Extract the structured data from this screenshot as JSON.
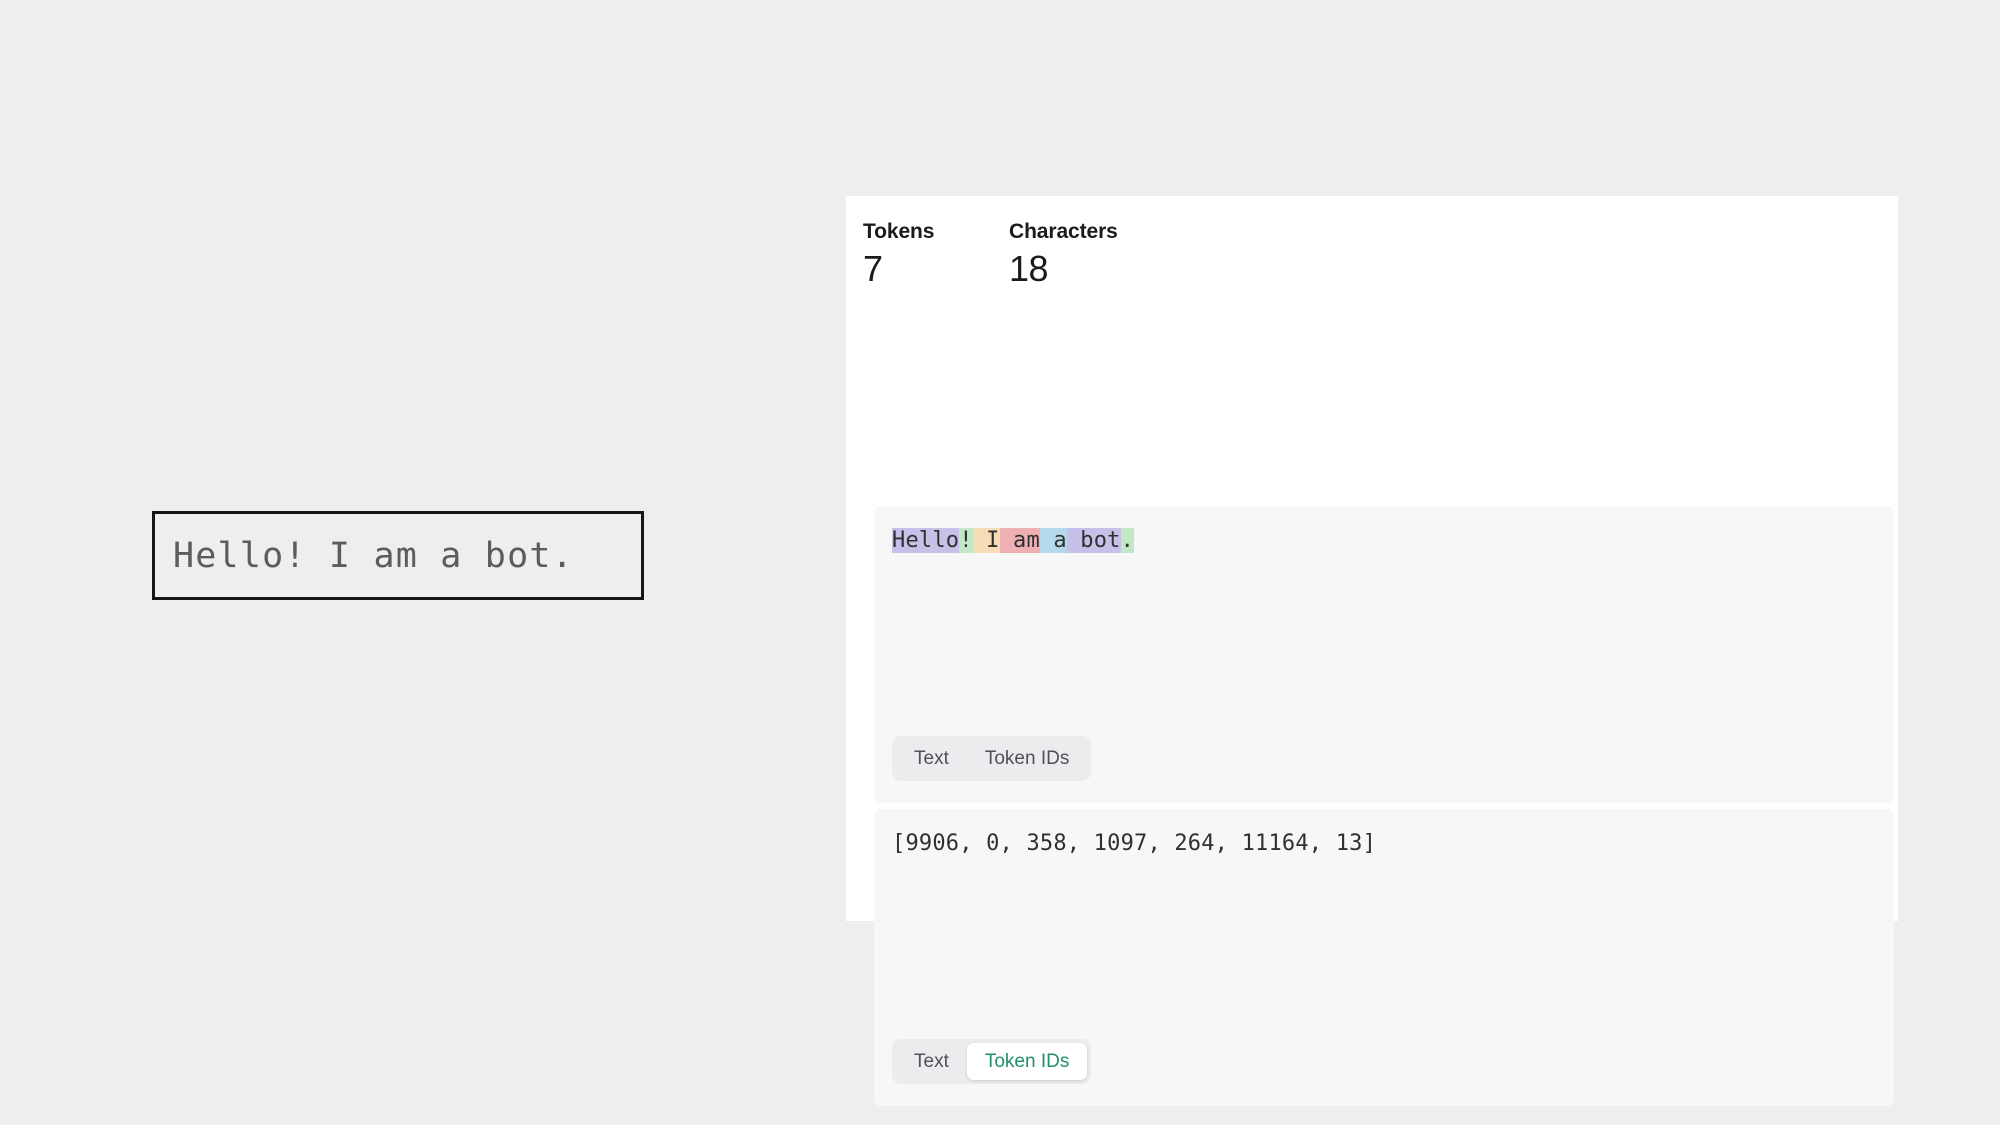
{
  "page": {
    "background_color": "#eeeeee"
  },
  "input": {
    "name": "prompt-textbox",
    "value": "Hello! I am a bot.",
    "text_color": "#5c5c5c",
    "border_color": "#161616"
  },
  "panel": {
    "background_color": "#ffffff",
    "stats": [
      {
        "label": "Tokens",
        "value": "7"
      },
      {
        "label": "Characters",
        "value": "18"
      }
    ],
    "text_card": {
      "tokens": [
        {
          "text": "Hello",
          "color": "#c9c0ea"
        },
        {
          "text": "!",
          "color": "#c2e8c6"
        },
        {
          "text": " I",
          "color": "#f7ddb7"
        },
        {
          "text": " am",
          "color": "#efb0b4"
        },
        {
          "text": " a",
          "color": "#b5d9ec"
        },
        {
          "text": " bot",
          "color": "#c9c0ea"
        },
        {
          "text": ".",
          "color": "#c2e8c6"
        }
      ],
      "toggle": {
        "options": [
          "Text",
          "Token IDs"
        ],
        "selected": "Text",
        "selected_visible": false
      }
    },
    "token_ids_card": {
      "value": "[9906, 0, 358, 1097, 264, 11164, 13]",
      "ids": [
        9906,
        0,
        358,
        1097,
        264,
        11164,
        13
      ],
      "toggle": {
        "options": [
          "Text",
          "Token IDs"
        ],
        "selected": "Token IDs",
        "selected_visible": true,
        "active_color": "#1f9168"
      }
    }
  }
}
